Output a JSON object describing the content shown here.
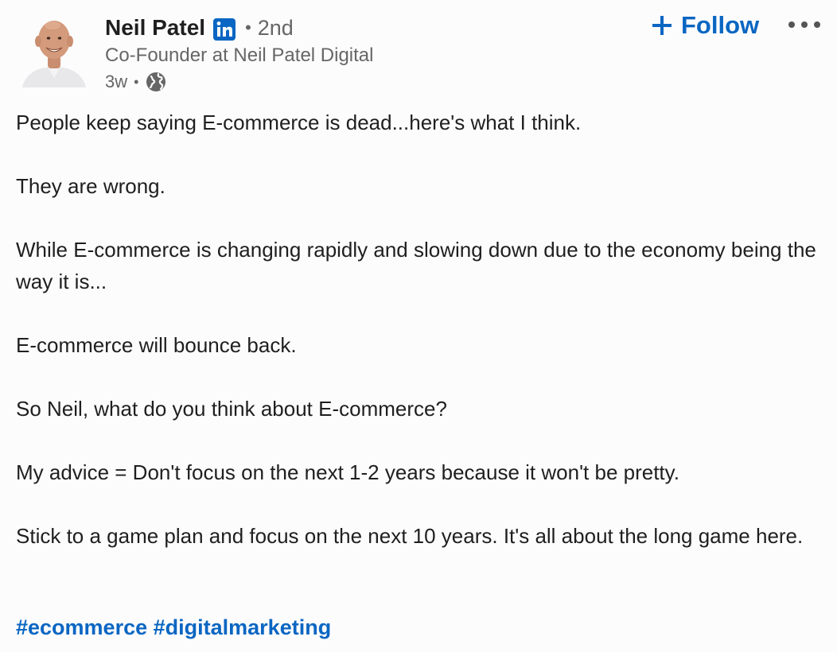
{
  "author": {
    "name": "Neil Patel",
    "badge_icon": "linkedin-icon",
    "connection_separator": "•",
    "connection_degree": "2nd",
    "headline": "Co-Founder at Neil Patel Digital",
    "posted_ago": "3w",
    "meta_separator": "•",
    "visibility_icon": "globe-icon"
  },
  "actions": {
    "follow_label": "Follow",
    "follow_icon": "plus-icon",
    "more_icon": "more-options-icon"
  },
  "post": {
    "paragraphs": [
      "People keep saying E-commerce is dead...here's what I think.",
      "They are wrong.",
      "While E-commerce is changing rapidly and slowing down due to the economy being the way it is...",
      "E-commerce will bounce back.",
      "So Neil, what do you think about E-commerce?",
      "My advice = Don't focus on the next 1-2 years because it won't be pretty.",
      "Stick to a game plan and focus on the next 10 years. It's all about the long game here."
    ],
    "hashtags": [
      "#ecommerce",
      "#digitalmarketing"
    ]
  },
  "colors": {
    "link_blue": "#0a66c2",
    "text_primary": "#1f1f1f",
    "text_secondary": "#666666",
    "background": "#fcfcfd"
  }
}
